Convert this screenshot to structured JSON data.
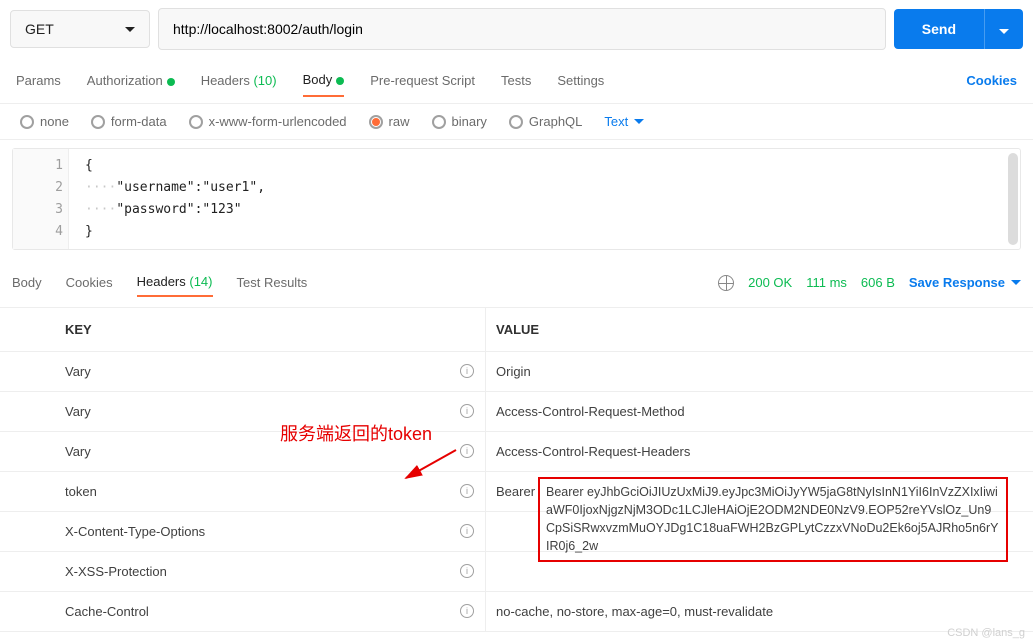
{
  "request": {
    "method": "GET",
    "url": "http://localhost:8002/auth/login",
    "send_label": "Send"
  },
  "req_tabs": {
    "params": "Params",
    "auth": "Authorization",
    "headers_label": "Headers",
    "headers_count": "(10)",
    "body": "Body",
    "prereq": "Pre-request Script",
    "tests": "Tests",
    "settings": "Settings",
    "cookies": "Cookies"
  },
  "body_types": {
    "none": "none",
    "formdata": "form-data",
    "xform": "x-www-form-urlencoded",
    "raw": "raw",
    "binary": "binary",
    "graphql": "GraphQL",
    "mode": "Text"
  },
  "editor_lines": [
    "{",
    "    \"username\":\"user1\",",
    "    \"password\":\"123\"",
    "}"
  ],
  "resp_tabs": {
    "body": "Body",
    "cookies": "Cookies",
    "headers_label": "Headers",
    "headers_count": "(14)",
    "test_results": "Test Results"
  },
  "resp_meta": {
    "status": "200 OK",
    "time": "111 ms",
    "size": "606 B",
    "save": "Save Response"
  },
  "headers_table": {
    "key_header": "KEY",
    "value_header": "VALUE",
    "rows": [
      {
        "k": "Vary",
        "v": "Origin"
      },
      {
        "k": "Vary",
        "v": "Access-Control-Request-Method"
      },
      {
        "k": "Vary",
        "v": "Access-Control-Request-Headers"
      },
      {
        "k": "token",
        "v": "Bearer"
      },
      {
        "k": "X-Content-Type-Options",
        "v": ""
      },
      {
        "k": "X-XSS-Protection",
        "v": ""
      },
      {
        "k": "Cache-Control",
        "v": "no-cache, no-store, max-age=0, must-revalidate"
      }
    ],
    "token_full": "eyJhbGciOiJIUzUxMiJ9.eyJpc3MiOiJyYW5jaG8tNyIsInN1YiI6InVzZXIxIiwiaWF0IjoxNjgzNjM3ODc1LCJleHAiOjE2ODM2NDE0NzV9.EOP52reYVslOz_Un9CpSiSRwxvzmMuOYJDg1C18uaFWH2BzGPLytCzzxVNoDu2Ek6oj5AJRho5n6rYIR0j6_2w"
  },
  "annotation": "服务端返回的token",
  "watermark": "CSDN @lans_g"
}
